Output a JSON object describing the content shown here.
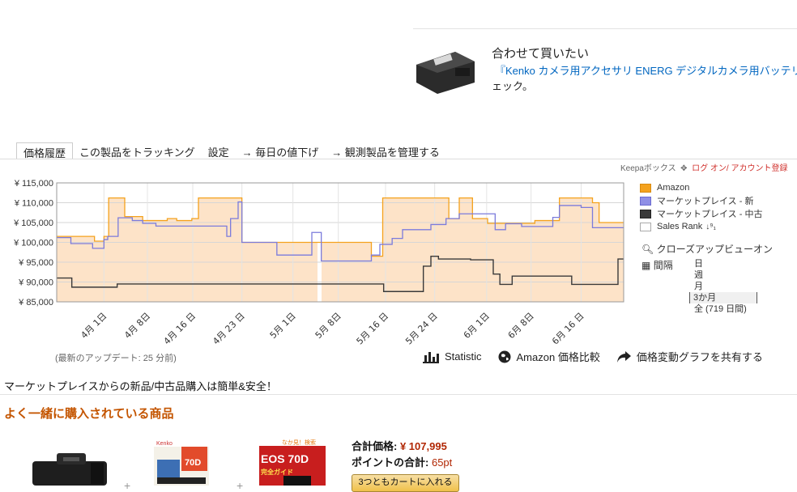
{
  "recommend": {
    "title": "合わせて買いたい",
    "link": "『Kenko カメラ用アクセサリ ENERG デジタルカメラ用バッテリ",
    "sub": "ェック。"
  },
  "tabs": [
    "価格履歴",
    "この製品をトラッキング",
    "設定",
    "→ 毎日の値下げ",
    "→ 観測製品を管理する"
  ],
  "keepa": {
    "box": "Keepaボックス",
    "login": "ログ オン/ アカウント登録"
  },
  "chart_data": {
    "type": "line",
    "y_ticks": [
      "¥ 115,000",
      "¥ 110,000",
      "¥ 105,000",
      "¥ 100,000",
      "¥ 95,000",
      "¥ 90,000",
      "¥ 85,000"
    ],
    "x_ticks": [
      "4月 1日",
      "4月 8日",
      "4月 16 日",
      "4月 23 日",
      "5月 1日",
      "5月 8日",
      "5月 16 日",
      "5月 24 日",
      "6月 1日",
      "6月 8日",
      "6月 16 日"
    ],
    "ylim": [
      85000,
      115000
    ],
    "grid": true,
    "series": [
      {
        "name": "Amazon",
        "color": "#f4a21d",
        "points": [
          [
            0,
            101500
          ],
          [
            4,
            101500
          ],
          [
            4,
            100300
          ],
          [
            5,
            100300
          ],
          [
            5,
            101500
          ],
          [
            5.5,
            101500
          ],
          [
            5.5,
            111200
          ],
          [
            7.2,
            111200
          ],
          [
            7.2,
            106500
          ],
          [
            9.1,
            106500
          ],
          [
            9.1,
            105500
          ],
          [
            11.7,
            105500
          ],
          [
            11.7,
            106000
          ],
          [
            12.7,
            106000
          ],
          [
            12.7,
            105500
          ],
          [
            14.3,
            105500
          ],
          [
            14.3,
            106000
          ],
          [
            15,
            106000
          ],
          [
            15,
            111200
          ],
          [
            19.6,
            111200
          ],
          [
            19.6,
            100000
          ],
          [
            33.3,
            100000
          ],
          [
            33.3,
            96500
          ],
          [
            34.5,
            96500
          ],
          [
            34.5,
            111200
          ],
          [
            41.5,
            111200
          ],
          [
            41.5,
            106000
          ],
          [
            42.6,
            106000
          ],
          [
            42.6,
            111200
          ],
          [
            44,
            111200
          ],
          [
            44,
            106000
          ],
          [
            45.6,
            106000
          ],
          [
            45.6,
            104800
          ],
          [
            50.6,
            104800
          ],
          [
            50.6,
            105500
          ],
          [
            53.2,
            105500
          ],
          [
            53.2,
            111200
          ],
          [
            56.7,
            111200
          ],
          [
            56.7,
            110000
          ],
          [
            57.4,
            110000
          ],
          [
            57.4,
            105000
          ],
          [
            60,
            105000
          ]
        ]
      },
      {
        "name": "マーケットプレイス - 新",
        "color": "#7b7bdc",
        "points": [
          [
            0,
            101200
          ],
          [
            1.5,
            101200
          ],
          [
            1.5,
            99700
          ],
          [
            3.8,
            99700
          ],
          [
            3.8,
            98500
          ],
          [
            5,
            98500
          ],
          [
            5,
            100700
          ],
          [
            5.4,
            100700
          ],
          [
            5.4,
            101500
          ],
          [
            6.5,
            101500
          ],
          [
            6.5,
            106200
          ],
          [
            8,
            106200
          ],
          [
            8,
            105500
          ],
          [
            9.1,
            105500
          ],
          [
            9.1,
            104800
          ],
          [
            10.5,
            104800
          ],
          [
            10.5,
            104100
          ],
          [
            18,
            104100
          ],
          [
            18,
            101500
          ],
          [
            18.4,
            101500
          ],
          [
            18.4,
            106000
          ],
          [
            19.2,
            106000
          ],
          [
            19.2,
            110200
          ],
          [
            19.6,
            110200
          ],
          [
            19.6,
            100000
          ],
          [
            23.3,
            100000
          ],
          [
            23.3,
            96800
          ],
          [
            27,
            96800
          ],
          [
            27,
            102500
          ],
          [
            28,
            102500
          ],
          [
            28,
            95300
          ],
          [
            33.3,
            95300
          ],
          [
            33.3,
            96800
          ],
          [
            34.2,
            96800
          ],
          [
            34.2,
            99500
          ],
          [
            35.5,
            99500
          ],
          [
            35.5,
            101000
          ],
          [
            36.6,
            101000
          ],
          [
            36.6,
            103200
          ],
          [
            39.6,
            103200
          ],
          [
            39.6,
            104500
          ],
          [
            41.2,
            104500
          ],
          [
            41.2,
            106000
          ],
          [
            42.6,
            106000
          ],
          [
            42.6,
            107200
          ],
          [
            46.4,
            107200
          ],
          [
            46.4,
            103200
          ],
          [
            47.5,
            103200
          ],
          [
            47.5,
            104700
          ],
          [
            49.2,
            104700
          ],
          [
            49.2,
            104000
          ],
          [
            52.5,
            104000
          ],
          [
            52.5,
            106300
          ],
          [
            53.2,
            106300
          ],
          [
            53.2,
            109300
          ],
          [
            55.5,
            109300
          ],
          [
            55.5,
            108800
          ],
          [
            56.7,
            108800
          ],
          [
            56.7,
            103700
          ],
          [
            60,
            103700
          ]
        ]
      },
      {
        "name": "マーケットプレイス - 中古",
        "color": "#3a3a3a",
        "points": [
          [
            0,
            91000
          ],
          [
            1.6,
            91000
          ],
          [
            1.6,
            88700
          ],
          [
            6.4,
            88700
          ],
          [
            6.4,
            89500
          ],
          [
            34.6,
            89500
          ],
          [
            34.6,
            87600
          ],
          [
            38.8,
            87600
          ],
          [
            38.8,
            94000
          ],
          [
            39.6,
            94000
          ],
          [
            39.6,
            96500
          ],
          [
            40.4,
            96500
          ],
          [
            40.4,
            95800
          ],
          [
            43.8,
            95800
          ],
          [
            43.8,
            95600
          ],
          [
            46.2,
            95600
          ],
          [
            46.2,
            92000
          ],
          [
            46.9,
            92000
          ],
          [
            46.9,
            89400
          ],
          [
            48.2,
            89400
          ],
          [
            48.2,
            91500
          ],
          [
            54.5,
            91500
          ],
          [
            54.5,
            89400
          ],
          [
            59.4,
            89400
          ],
          [
            59.4,
            95800
          ],
          [
            60,
            95800
          ]
        ]
      },
      {
        "name": "Sales Rank",
        "color": "#ffffff",
        "points": []
      }
    ],
    "x_range": [
      0,
      60
    ],
    "tick_x": [
      5,
      9.6,
      14.4,
      19.6,
      25,
      29.8,
      34.8,
      40,
      45.5,
      50.2,
      55.5
    ]
  },
  "controls": {
    "zoom": "クローズアップビューオン",
    "interval": "間隔",
    "options": [
      "日",
      "週",
      "月",
      "3か月",
      "全 (719 日間)"
    ],
    "selected": "3か月"
  },
  "updated": "(最新のアップデート: 25 分前)",
  "actions": [
    "Statistic",
    "Amazon 価格比較",
    "価格変動グラフを共有する"
  ],
  "marketplace": "マーケットプレイスからの新品/中古品購入は簡単&安全！",
  "fbt": {
    "title": "よく一緒に購入されている商品",
    "total_label": "合計価格:",
    "total": "¥ 107,995",
    "points_label": "ポイントの合計:",
    "points": "65pt",
    "cart": "3つともカートに入れる",
    "book1": "70D",
    "book2_top": "なか見！検索",
    "book2": "EOS 70D",
    "book2_sub": "完全ガイド"
  }
}
